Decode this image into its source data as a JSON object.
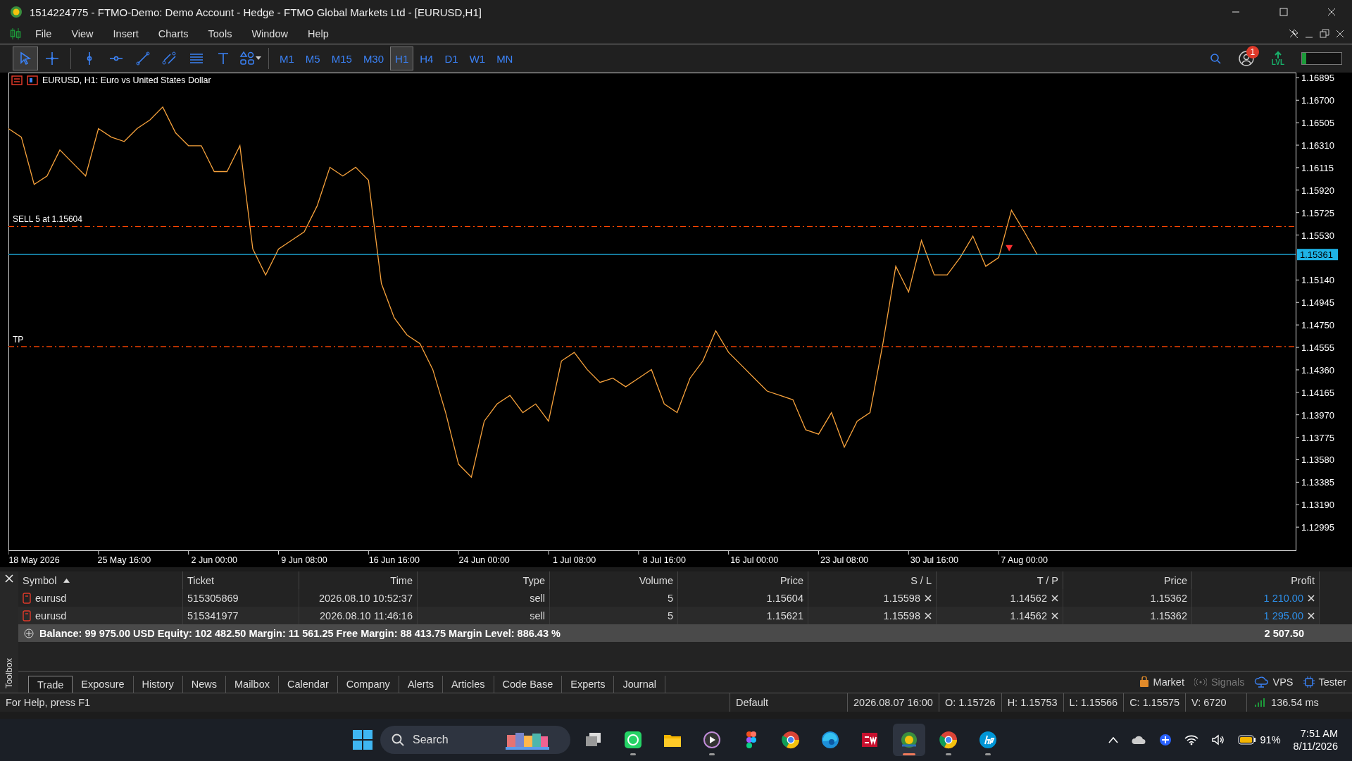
{
  "window": {
    "title": "1514224775 - FTMO-Demo: Demo Account - Hedge - FTMO Global Markets Ltd - [EURUSD,H1]"
  },
  "menu": [
    "File",
    "View",
    "Insert",
    "Charts",
    "Tools",
    "Window",
    "Help"
  ],
  "toolbar": {
    "tools": [
      {
        "kind": "cursor",
        "selected": true
      },
      {
        "kind": "crosshair",
        "selected": false
      },
      {
        "kind": "vline",
        "selected": false
      },
      {
        "kind": "hline",
        "selected": false
      },
      {
        "kind": "trendline",
        "selected": false
      },
      {
        "kind": "channel",
        "selected": false
      },
      {
        "kind": "fibo",
        "selected": false
      },
      {
        "kind": "text",
        "selected": false
      },
      {
        "kind": "shapes",
        "selected": false
      }
    ],
    "timeframes": [
      {
        "label": "M1",
        "selected": false
      },
      {
        "label": "M5",
        "selected": false
      },
      {
        "label": "M15",
        "selected": false
      },
      {
        "label": "M30",
        "selected": false
      },
      {
        "label": "H1",
        "selected": true
      },
      {
        "label": "H4",
        "selected": false
      },
      {
        "label": "D1",
        "selected": false
      },
      {
        "label": "W1",
        "selected": false
      },
      {
        "label": "MN",
        "selected": false
      }
    ],
    "notifications": "1",
    "lvl_label": "LVL",
    "meter": {
      "level": 0.1
    }
  },
  "chart": {
    "chart_data": {
      "type": "line",
      "title": "EURUSD, H1:  Euro vs United States Dollar",
      "categories": [
        null,
        null,
        "18 May 2026",
        null,
        null,
        null,
        null,
        null,
        null,
        "25 May 16:00",
        null,
        null,
        null,
        null,
        null,
        null,
        "2 Jun 00:00",
        null,
        null,
        null,
        null,
        null,
        null,
        "9 Jun 08:00",
        null,
        null,
        null,
        null,
        null,
        null,
        "16 Jun 16:00",
        null,
        null,
        null,
        null,
        null,
        null,
        "24 Jun 00:00",
        null,
        null,
        null,
        null,
        null,
        null,
        "1 Jul 08:00",
        null,
        null,
        null,
        null,
        null,
        null,
        "8 Jul 16:00",
        null,
        null,
        null,
        null,
        null,
        null,
        "16 Jul 00:00",
        null,
        null,
        null,
        null,
        null,
        null,
        "23 Jul 08:00",
        null,
        null,
        null,
        null,
        null,
        null,
        "30 Jul 16:00",
        null,
        null,
        null,
        null,
        null,
        null,
        "7 Aug 00:00",
        null
      ],
      "series": [
        {
          "color": "#f7a23c",
          "values": [
            1.16454,
            1.1638,
            1.15969,
            1.16043,
            1.16268,
            1.16155,
            1.16043,
            1.16454,
            1.1638,
            1.16342,
            1.16454,
            1.16529,
            1.16641,
            1.16417,
            1.16305,
            1.16305,
            1.16081,
            1.16081,
            1.16305,
            1.15409,
            1.15184,
            1.15409,
            1.15483,
            1.15558,
            1.15782,
            1.16118,
            1.16043,
            1.16118,
            1.16006,
            1.1511,
            1.14811,
            1.14662,
            1.14587,
            1.14363,
            1.13989,
            1.13541,
            1.13429,
            1.13915,
            1.14064,
            1.14139,
            1.13989,
            1.14064,
            1.13915,
            1.14437,
            1.14512,
            1.14363,
            1.14251,
            1.14288,
            1.14213,
            1.14288,
            1.14363,
            1.14064,
            1.13989,
            1.14288,
            1.14437,
            1.14699,
            1.14512,
            1.144,
            1.14288,
            1.14176,
            1.14139,
            1.14101,
            1.1384,
            1.13802,
            1.13989,
            1.1369,
            1.13915,
            1.13989,
            1.14587,
            1.15259,
            1.15035,
            1.15483,
            1.15184,
            1.15184,
            1.15334,
            1.15521,
            1.15259,
            1.15334,
            1.15745,
            1.15558,
            1.15361
          ]
        }
      ],
      "ylim": [
        1.12794,
        1.1694
      ],
      "yticks": [
        {
          "value": 1.16895,
          "label": "1.16895"
        },
        {
          "value": 1.167,
          "label": "1.16700"
        },
        {
          "value": 1.16505,
          "label": "1.16505"
        },
        {
          "value": 1.1631,
          "label": "1.16310"
        },
        {
          "value": 1.16115,
          "label": "1.16115"
        },
        {
          "value": 1.1592,
          "label": "1.15920"
        },
        {
          "value": 1.15725,
          "label": "1.15725"
        },
        {
          "value": 1.1553,
          "label": "1.15530"
        },
        {
          "value": 1.1514,
          "label": "1.15140"
        },
        {
          "value": 1.14945,
          "label": "1.14945"
        },
        {
          "value": 1.1475,
          "label": "1.14750"
        },
        {
          "value": 1.14555,
          "label": "1.14555"
        },
        {
          "value": 1.1436,
          "label": "1.14360"
        },
        {
          "value": 1.14165,
          "label": "1.14165"
        },
        {
          "value": 1.1397,
          "label": "1.13970"
        },
        {
          "value": 1.13775,
          "label": "1.13775"
        },
        {
          "value": 1.1358,
          "label": "1.13580"
        },
        {
          "value": 1.13385,
          "label": "1.13385"
        },
        {
          "value": 1.1319,
          "label": "1.13190"
        },
        {
          "value": 1.12995,
          "label": "1.12995"
        }
      ],
      "ref_lines": [
        {
          "axis": "y",
          "value": 1.15604,
          "label": "SELL 5 at 1.15604",
          "color": "#ff4500"
        },
        {
          "axis": "y",
          "value": 1.14562,
          "label": "TP",
          "color": "#ff4500"
        },
        {
          "axis": "y",
          "value": 1.15361,
          "color": "#1fb3e6"
        }
      ]
    },
    "price_tag": "1.15361"
  },
  "toolbox": {
    "label": "Toolbox",
    "columns": [
      {
        "label": "Symbol",
        "sorted": true
      },
      {
        "label": "Ticket",
        "sorted": false
      },
      {
        "label": "Time",
        "sorted": false
      },
      {
        "label": "Type",
        "sorted": false
      },
      {
        "label": "Volume",
        "sorted": false
      },
      {
        "label": "Price",
        "sorted": false
      },
      {
        "label": "S / L",
        "sorted": false
      },
      {
        "label": "T / P",
        "sorted": false
      },
      {
        "label": "Price",
        "sorted": false
      },
      {
        "label": "Profit",
        "sorted": false
      }
    ],
    "rows": [
      {
        "symbol": "eurusd",
        "ticket": "515305869",
        "time": "2026.08.10 10:52:37",
        "type": "sell",
        "volume": "5",
        "price": "1.15604",
        "sl": "1.15598",
        "tp": "1.14562",
        "current_price": "1.15362",
        "profit": "1 210.00"
      },
      {
        "symbol": "eurusd",
        "ticket": "515341977",
        "time": "2026.08.10 11:46:16",
        "type": "sell",
        "volume": "5",
        "price": "1.15621",
        "sl": "1.15598",
        "tp": "1.14562",
        "current_price": "1.15362",
        "profit": "1 295.00"
      }
    ],
    "summary": {
      "text": "Balance: 99 975.00 USD  Equity: 102 482.50  Margin: 11 561.25  Free Margin: 88 413.75  Margin Level: 886.43 %",
      "total": "2 507.50"
    },
    "tabs": [
      {
        "label": "Trade",
        "selected": true
      },
      {
        "label": "Exposure",
        "selected": false
      },
      {
        "label": "History",
        "selected": false
      },
      {
        "label": "News",
        "selected": false
      },
      {
        "label": "Mailbox",
        "selected": false
      },
      {
        "label": "Calendar",
        "selected": false
      },
      {
        "label": "Company",
        "selected": false
      },
      {
        "label": "Alerts",
        "selected": false
      },
      {
        "label": "Articles",
        "selected": false
      },
      {
        "label": "Code Base",
        "selected": false
      },
      {
        "label": "Experts",
        "selected": false
      },
      {
        "label": "Journal",
        "selected": false
      }
    ],
    "services": [
      {
        "kind": "market",
        "label": "Market",
        "disabled": false
      },
      {
        "kind": "signals",
        "label": "Signals",
        "disabled": true
      },
      {
        "kind": "vps",
        "label": "VPS",
        "disabled": false
      },
      {
        "kind": "tester",
        "label": "Tester",
        "disabled": false
      }
    ]
  },
  "status_bar": {
    "help": "For Help, press F1",
    "profile": "Default",
    "datetime": "2026.08.07 16:00",
    "open": "O: 1.15726",
    "high": "H: 1.15753",
    "low": "L: 1.15566",
    "close": "C: 1.15575",
    "volume": "V: 6720",
    "ping": "136.54 ms"
  },
  "taskbar": {
    "search": {
      "placeholder": "Search"
    },
    "apps": [
      {
        "kind": "taskview",
        "running": false,
        "selected": false
      },
      {
        "kind": "whatsapp",
        "running": true,
        "selected": false
      },
      {
        "kind": "files",
        "running": false,
        "selected": false
      },
      {
        "kind": "media",
        "running": true,
        "selected": false
      },
      {
        "kind": "figma",
        "running": false,
        "selected": false
      },
      {
        "kind": "chrome",
        "running": false,
        "selected": false
      },
      {
        "kind": "edge",
        "running": false,
        "selected": false
      },
      {
        "kind": "sw",
        "running": false,
        "selected": false
      },
      {
        "kind": "mt5",
        "running": true,
        "selected": true
      },
      {
        "kind": "chrome",
        "running": true,
        "selected": false
      },
      {
        "kind": "hp",
        "running": true,
        "selected": false
      }
    ],
    "battery": "91%",
    "time": "7:51 AM",
    "date": "8/11/2026"
  }
}
